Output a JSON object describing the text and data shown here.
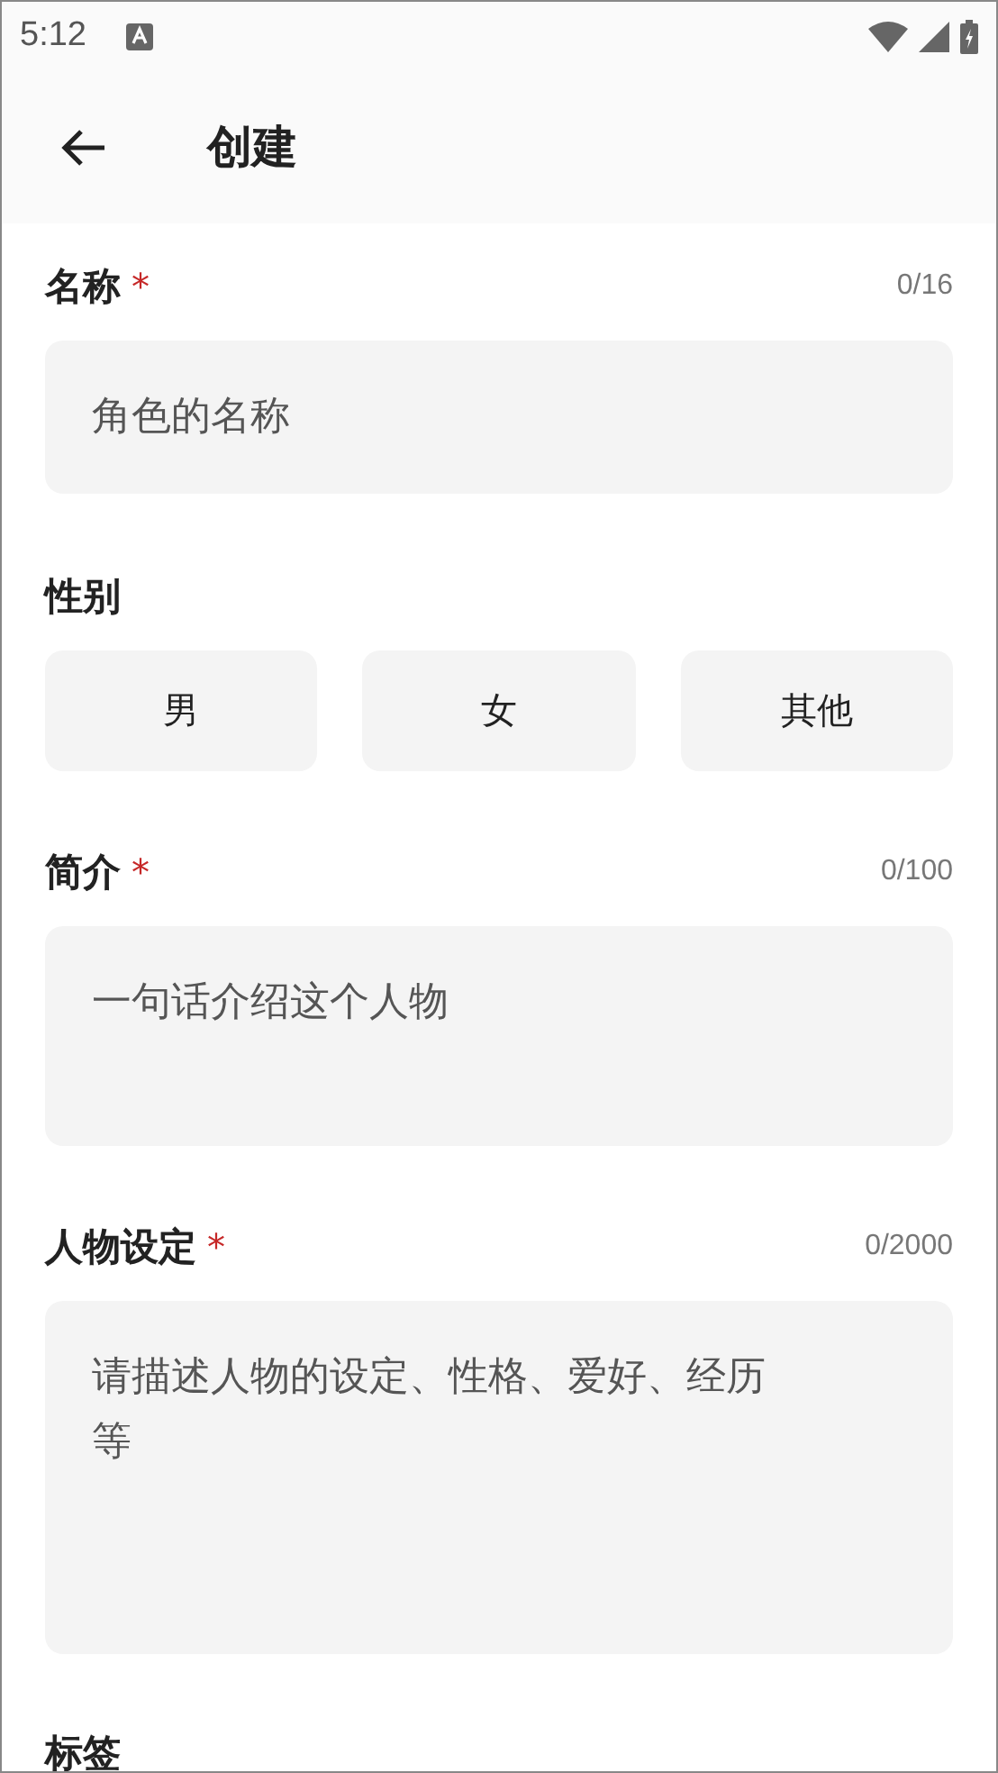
{
  "status_bar": {
    "time": "5:12"
  },
  "header": {
    "title": "创建"
  },
  "name": {
    "label": "名称",
    "required_mark": "*",
    "counter": "0/16",
    "placeholder": "角色的名称"
  },
  "gender": {
    "label": "性别",
    "options": [
      {
        "label": "男",
        "selected": false
      },
      {
        "label": "女",
        "selected": false
      },
      {
        "label": "其他",
        "selected": false
      }
    ]
  },
  "intro": {
    "label": "简介",
    "required_mark": "*",
    "counter": "0/100",
    "placeholder": "一句话介绍这个人物"
  },
  "persona": {
    "label": "人物设定",
    "required_mark": "*",
    "counter": "0/2000",
    "placeholder": "请描述人物的设定、性格、爱好、经历等"
  },
  "tags": {
    "label": "标签"
  }
}
